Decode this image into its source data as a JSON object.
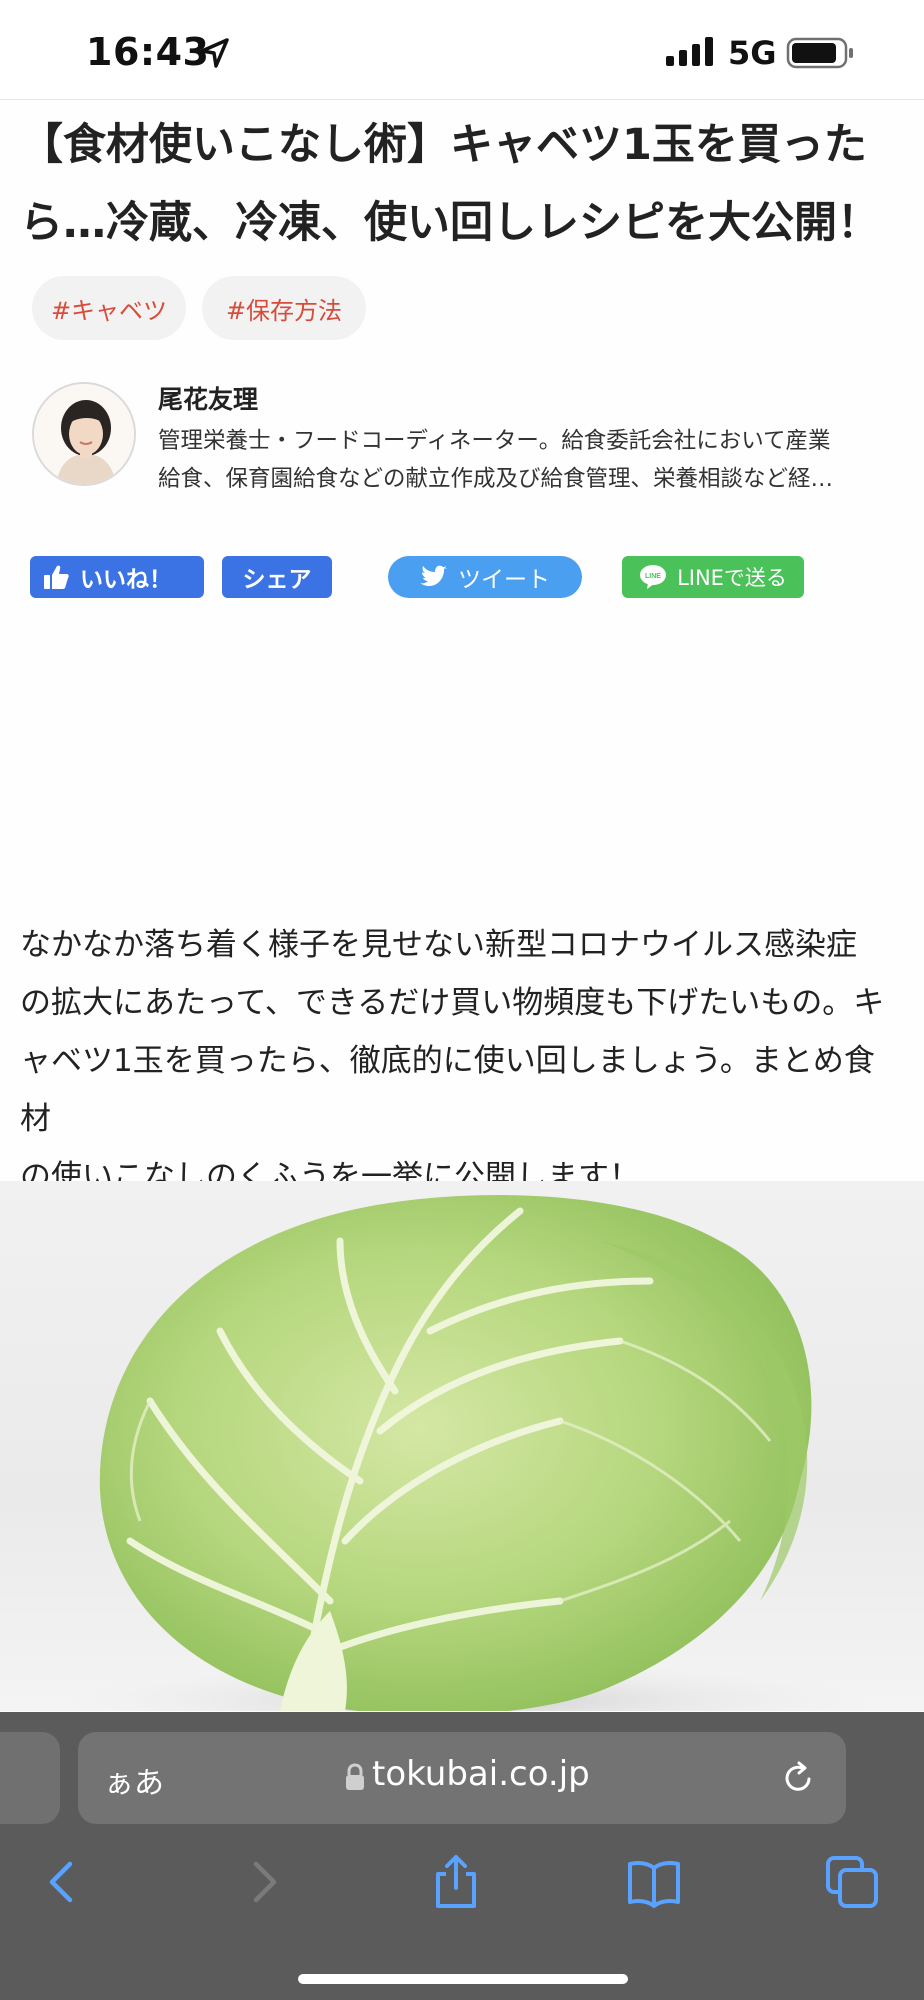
{
  "status_bar": {
    "time": "16:43",
    "network": "5G",
    "icons": [
      "location-arrow-icon",
      "signal-bars-icon",
      "battery-icon"
    ]
  },
  "article": {
    "title_line1": "【食材使いこなし術】キャベツ1玉を買った",
    "title_line2": "ら…冷蔵、冷凍、使い回しレシピを大公開！",
    "tags": [
      "#キャベツ",
      "#保存方法"
    ],
    "tag_color": "#d84b3b",
    "author": {
      "name": "尾花友理",
      "bio_line1": "管理栄養士・フードコーディネーター。給食委託会社において産業",
      "bio_line2": "給食、保育園給食などの献立作成及び給食管理、栄養相談など経…"
    },
    "share": {
      "like_label": "いいね！",
      "share_label": "シェア",
      "tweet_label": "ツイート",
      "line_label": "LINEで送る",
      "colors": {
        "facebook": "#3b73e4",
        "twitter": "#4a9ff0",
        "line": "#4bc259"
      }
    },
    "lead": {
      "line1": "なかなか落ち着く様子を見せない新型コロナウイルス感染症",
      "line2": "の拡大にあたって、できるだけ買い物頻度も下げたいもの。キ",
      "line3": "ャベツ1玉を買ったら、徹底的に使い回しましょう。まとめ食材",
      "line4": "の使いこなしのくふうを一挙に公開します！"
    },
    "hero_image": "cabbage-photo"
  },
  "browser": {
    "text_size_label": "ぁあ",
    "url": "tokubai.co.jp",
    "toolbar_icons": [
      "back-icon",
      "forward-icon",
      "share-icon",
      "bookmarks-icon",
      "tabs-icon"
    ]
  }
}
